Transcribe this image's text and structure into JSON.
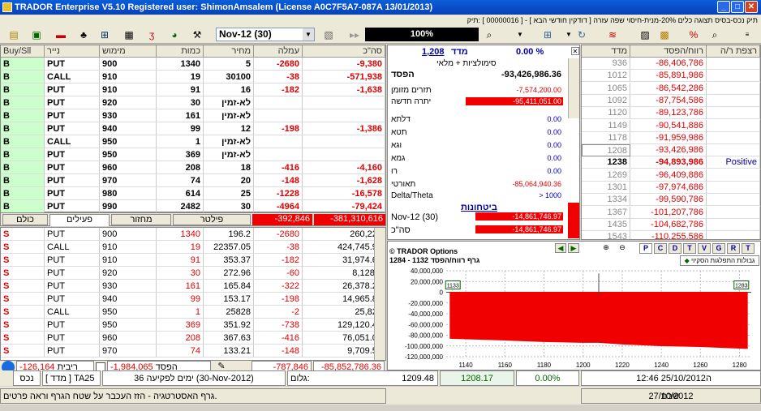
{
  "title": "TRADOR Enterprise  V5.10    Registered user: ShimonAmsalem  (License  A0C7F5A7-087A  13/01/2013)",
  "menu": "תיק  נכס-בסיס  תצוגה  כלים  20%-מנית-חיסוי  שפה  עזרה  [ דודקין חודשי הבא ] - [ 00000016 ]  :תיק",
  "combo_value": "Nov-12 (30)",
  "pct_value": "100%",
  "top_grid": {
    "headers": [
      "Buy/Sll",
      "נייר",
      "מימוש",
      "כמות",
      "מחיר",
      "עמלה",
      "סה\"כ"
    ],
    "rows": [
      [
        "B",
        "PUT",
        "900",
        "1340",
        "5",
        "-2680",
        "-9,380"
      ],
      [
        "B",
        "CALL",
        "910",
        "19",
        "30100",
        "-38",
        "-571,938"
      ],
      [
        "B",
        "PUT",
        "910",
        "91",
        "16",
        "-182",
        "-1,638"
      ],
      [
        "B",
        "PUT",
        "920",
        "30",
        "לא-זמין",
        "",
        ""
      ],
      [
        "B",
        "PUT",
        "930",
        "161",
        "לא-זמין",
        "",
        ""
      ],
      [
        "B",
        "PUT",
        "940",
        "99",
        "12",
        "-198",
        "-1,386"
      ],
      [
        "B",
        "CALL",
        "950",
        "1",
        "לא-זמין",
        "",
        ""
      ],
      [
        "B",
        "PUT",
        "950",
        "369",
        "לא-זמין",
        "",
        ""
      ],
      [
        "B",
        "PUT",
        "960",
        "208",
        "18",
        "-416",
        "-4,160"
      ],
      [
        "B",
        "PUT",
        "970",
        "74",
        "20",
        "-148",
        "-1,628"
      ],
      [
        "B",
        "PUT",
        "980",
        "614",
        "25",
        "-1228",
        "-16,578"
      ],
      [
        "B",
        "PUT",
        "990",
        "2482",
        "30",
        "-4964",
        "-79,424"
      ]
    ]
  },
  "tabs": [
    "כולם",
    "פעילים",
    "מחזור",
    "פילטר"
  ],
  "tab_totals": [
    "-392,846",
    "-381,310,616"
  ],
  "bottom_grid": {
    "rows": [
      [
        "S",
        "PUT",
        "900",
        "1340",
        "196.2",
        "-2680",
        "260,228"
      ],
      [
        "S",
        "CALL",
        "910",
        "19",
        "22357.05",
        "-38",
        "424,745.95"
      ],
      [
        "S",
        "PUT",
        "910",
        "91",
        "353.37",
        "-182",
        "31,974.67"
      ],
      [
        "S",
        "PUT",
        "920",
        "30",
        "272.96",
        "-60",
        "8,128.8"
      ],
      [
        "S",
        "PUT",
        "930",
        "161",
        "165.84",
        "-322",
        "26,378.24"
      ],
      [
        "S",
        "PUT",
        "940",
        "99",
        "153.17",
        "-198",
        "14,965.83"
      ],
      [
        "S",
        "CALL",
        "950",
        "1",
        "25828",
        "-2",
        "25,826"
      ],
      [
        "S",
        "PUT",
        "950",
        "369",
        "351.92",
        "-738",
        "129,120.48"
      ],
      [
        "S",
        "PUT",
        "960",
        "208",
        "367.63",
        "-416",
        "76,051.04"
      ],
      [
        "S",
        "PUT",
        "970",
        "74",
        "133.21",
        "-148",
        "9,709.54"
      ]
    ]
  },
  "bottom_left_bar": {
    "ribit_val": "-126,164",
    "ribit_lbl": "ריבית",
    "hefsed_val": "-1,984,065",
    "hefsed_lbl": "הפסד",
    "tot1": "-787,846",
    "tot2": "-85,852,786.36"
  },
  "summary": {
    "madad_lbl": "מדד",
    "madad_val": "1,208",
    "madad_pct": "0.00 %",
    "subtitle": "סימולציות + מלאי",
    "loss_lbl": "הפסד",
    "loss_val": "-93,426,986.36",
    "rows": [
      [
        "תזרים מזומן",
        "-7,574,200.00"
      ],
      [
        "יתרה חדשה",
        "-95,411,051.00"
      ],
      [
        "דלתא",
        "0.00"
      ],
      [
        "תטא",
        "0.00"
      ],
      [
        "וגא",
        "0.00"
      ],
      [
        "גמא",
        "0.00"
      ],
      [
        "רו",
        "0.00"
      ],
      [
        "תאורטי",
        "-85,064,940.36"
      ],
      [
        "Delta/Theta",
        "> 1000"
      ]
    ],
    "bitachonot": "ביטחונות",
    "b_rows": [
      [
        "Nov-12 (30)",
        "-14,861,746.97"
      ],
      [
        "סה\"כ",
        "-14,861,746.97"
      ]
    ]
  },
  "right_grid": {
    "headers": [
      "מדד",
      "רווח/הפסד",
      "רצפת ר/ה"
    ],
    "rows": [
      [
        "936",
        "-86,406,786",
        ""
      ],
      [
        "1012",
        "-85,891,986",
        ""
      ],
      [
        "1065",
        "-86,542,286",
        ""
      ],
      [
        "1092",
        "-87,754,586",
        ""
      ],
      [
        "1120",
        "-89,123,786",
        ""
      ],
      [
        "1149",
        "-90,541,886",
        ""
      ],
      [
        "1178",
        "-91,959,986",
        ""
      ],
      [
        "1208",
        "-93,426,986",
        ""
      ],
      [
        "1238",
        "-94,893,986",
        "Positive"
      ],
      [
        "1269",
        "-96,409,886",
        ""
      ],
      [
        "1301",
        "-97,974,686",
        ""
      ],
      [
        "1334",
        "-99,590,786",
        ""
      ],
      [
        "1367",
        "-101,207,786",
        ""
      ],
      [
        "1435",
        "-104,682,786",
        ""
      ],
      [
        "1543",
        "-110,255,586",
        ""
      ]
    ]
  },
  "chart_data": {
    "type": "area",
    "title": "© TRADOR Options",
    "subtitle": "גרף רווח/הפסד 1132 - 1284",
    "legend": "גבולות התפלגות הסקיוי",
    "x": [
      1132,
      1160,
      1180,
      1200,
      1208,
      1220,
      1240,
      1260,
      1284
    ],
    "values": [
      -85891986,
      -89123786,
      -91959986,
      -93426986,
      -93426986,
      -96409886,
      -99590786,
      -101207786,
      -104682786
    ],
    "xticks": [
      "1140",
      "1160",
      "1180",
      "1200",
      "1220",
      "1240",
      "1260",
      "1280"
    ],
    "yticks": [
      "40,000,000",
      "20,000,000",
      "0",
      "-20,000,000",
      "-40,000,000",
      "-60,000,000",
      "-80,000,000",
      "-100,000,000",
      "-120,000,000"
    ],
    "ylim": [
      -120000000,
      40000000
    ],
    "xlim": [
      1130,
      1286
    ],
    "marker_left": "1133",
    "marker_right": "1283",
    "color": "#f00000",
    "tabs": [
      "P",
      "C",
      "D",
      "T",
      "V",
      "G",
      "R",
      "T"
    ]
  },
  "status": {
    "a": "נכס",
    "b": "TA25",
    "c": "[ מדד ]",
    "d": "(30-Nov-2012)",
    "e": "36",
    "f": "ימים לפקיעה",
    "g": "1209.48",
    "h": "גלום:",
    "i": "1208.17",
    "j": "0.00%",
    "k": "12:46  25/10/2012",
    "l": "ה"
  },
  "bottom": {
    "msg": "גרף האסטרטגיה - הזז העכבר על שטח הגרף וראה פרטים.",
    "date": "27/10/2012",
    "day": "שבת"
  }
}
